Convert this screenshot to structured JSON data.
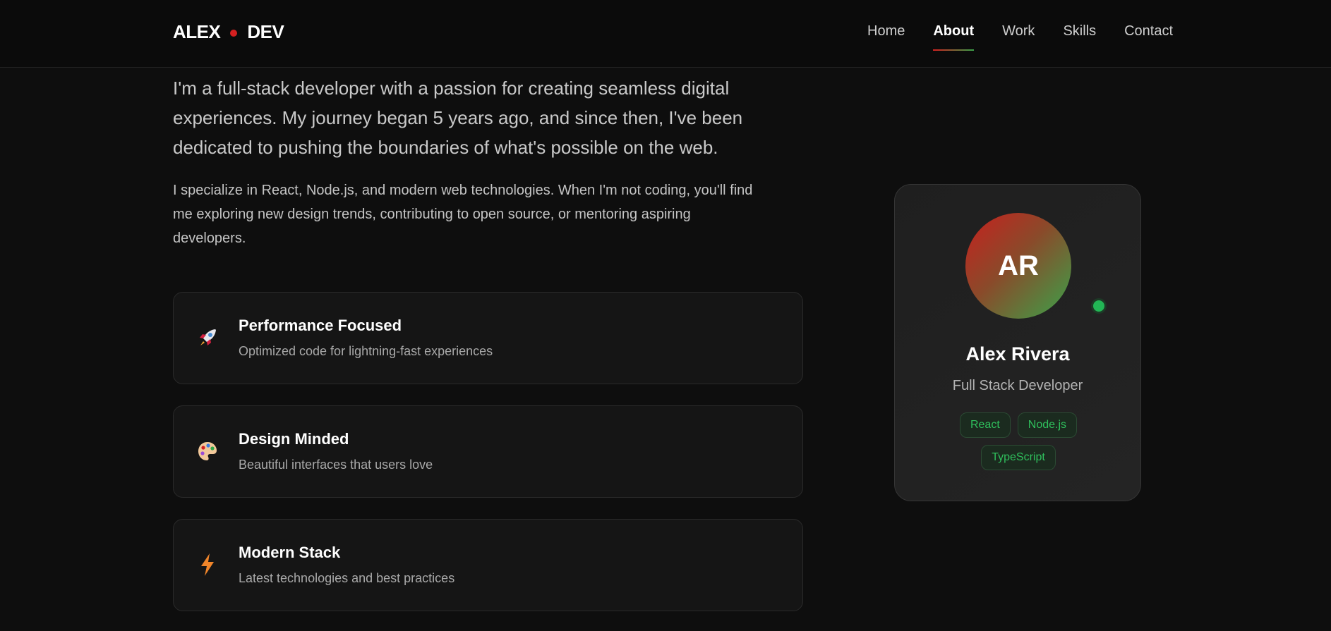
{
  "header": {
    "logo_left": "ALEX",
    "logo_right": "DEV",
    "accent_color": "#d42020",
    "nav": [
      {
        "label": "Home",
        "active": false
      },
      {
        "label": "About",
        "active": true
      },
      {
        "label": "Work",
        "active": false
      },
      {
        "label": "Skills",
        "active": false
      },
      {
        "label": "Contact",
        "active": false
      }
    ]
  },
  "about": {
    "lead": "I'm a full-stack developer with a passion for creating seamless digital experiences. My journey began 5 years ago, and since then, I've been dedicated to pushing the boundaries of what's possible on the web.",
    "sub": "I specialize in React, Node.js, and modern web technologies. When I'm not coding, you'll find me exploring new design trends, contributing to open source, or mentoring aspiring developers."
  },
  "features": [
    {
      "icon": "rocket-icon",
      "title": "Performance Focused",
      "description": "Optimized code for lightning-fast experiences"
    },
    {
      "icon": "palette-icon",
      "title": "Design Minded",
      "description": "Beautiful interfaces that users love"
    },
    {
      "icon": "lightning-icon",
      "title": "Modern Stack",
      "description": "Latest technologies and best practices"
    }
  ],
  "profile": {
    "initials": "AR",
    "name": "Alex Rivera",
    "role": "Full Stack Developer",
    "status_color": "#22b655",
    "tags": [
      "React",
      "Node.js",
      "TypeScript"
    ]
  }
}
